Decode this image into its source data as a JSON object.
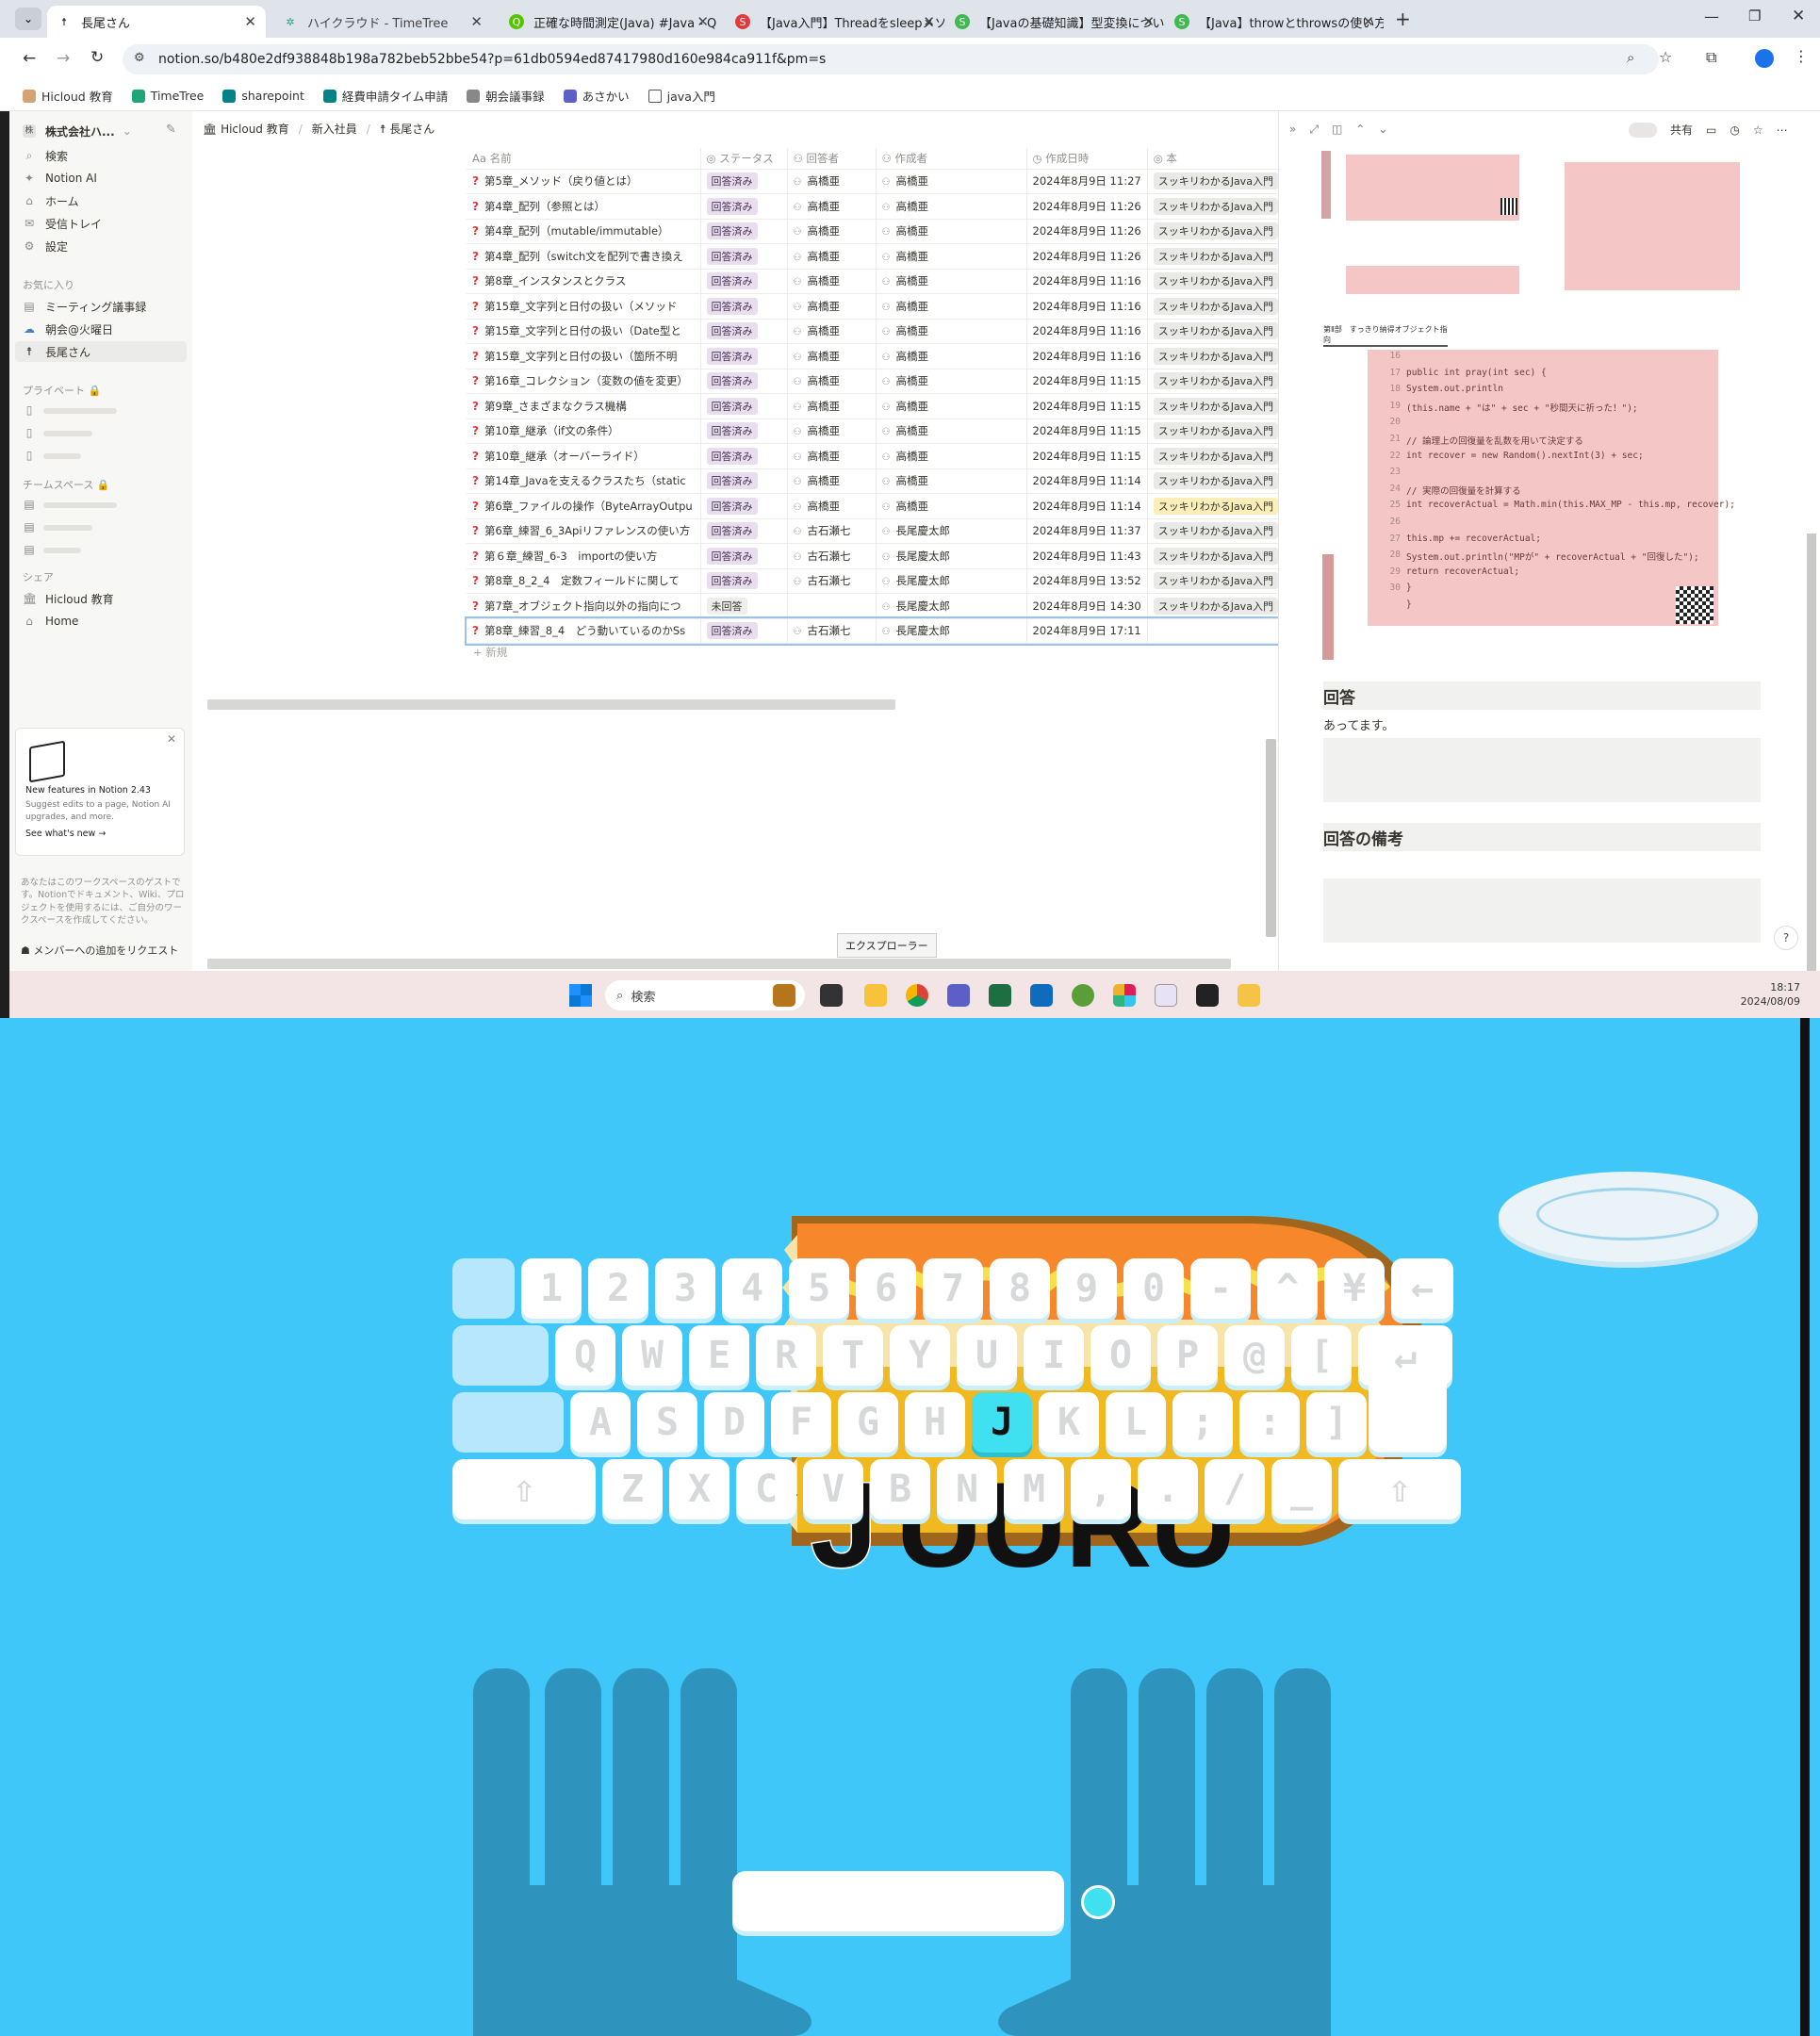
{
  "browser": {
    "tabs": [
      {
        "title": "長尾さん",
        "active": true
      },
      {
        "title": "ハイクラウド - TimeTree"
      },
      {
        "title": "正確な時間測定(Java) #Java - Q"
      },
      {
        "title": "【Java入門】Threadをsleepメソッド"
      },
      {
        "title": "【Javaの基礎知識】型変換について"
      },
      {
        "title": "【Java】throwとthrowsの使い方を"
      }
    ],
    "url": "notion.so/b480e2df938848b198a782beb52bbe54?p=61db0594ed87417980d160e984ca911f&pm=s",
    "bookmarks": [
      "Hicloud 教育",
      "TimeTree",
      "sharepoint",
      "経費申請タイム申請",
      "朝会議事録",
      "あさかい",
      "java入門"
    ]
  },
  "sidebar": {
    "workspace": "株式会社ハ...",
    "nav": [
      "検索",
      "Notion AI",
      "ホーム",
      "受信トレイ",
      "設定"
    ],
    "favorites_label": "お気に入り",
    "favorites": [
      "ミーティング議事録",
      "朝会@火曜日",
      "長尾さん"
    ],
    "private_label": "プライベート",
    "team_label": "チームスペース",
    "shared_label": "シェア",
    "shared": [
      "Hicloud 教育",
      "Home"
    ],
    "promo_title": "New features in Notion 2.43",
    "promo_body": "Suggest edits to a page, Notion AI upgrades, and more.",
    "promo_link": "See what's new",
    "guest_note": "あなたはこのワークスペースのゲストです。Notionでドキュメント、Wiki、プロジェクトを使用するには、ご自分のワークスペースを作成してください。",
    "request_member": "メンバーへの追加をリクエスト"
  },
  "breadcrumb": [
    "Hicloud 教育",
    "新入社員",
    "長尾さん"
  ],
  "table": {
    "headers": [
      "名前",
      "ステータス",
      "回答者",
      "作成者",
      "作成日時",
      "本"
    ],
    "rows": [
      [
        "第5章_メソッド（戻り値とは）",
        "回答済み",
        "高橋亜",
        "高橋亜",
        "2024年8月9日 11:27",
        "スッキリわかるJava入門"
      ],
      [
        "第4章_配列（参照とは）",
        "回答済み",
        "高橋亜",
        "高橋亜",
        "2024年8月9日 11:26",
        "スッキリわかるJava入門"
      ],
      [
        "第4章_配列（mutable/immutable）",
        "回答済み",
        "高橋亜",
        "高橋亜",
        "2024年8月9日 11:26",
        "スッキリわかるJava入門"
      ],
      [
        "第4章_配列（switch文を配列で書き換え",
        "回答済み",
        "高橋亜",
        "高橋亜",
        "2024年8月9日 11:26",
        "スッキリわかるJava入門"
      ],
      [
        "第8章_インスタンスとクラス",
        "回答済み",
        "高橋亜",
        "高橋亜",
        "2024年8月9日 11:16",
        "スッキリわかるJava入門"
      ],
      [
        "第15章_文字列と日付の扱い（メソッド",
        "回答済み",
        "高橋亜",
        "高橋亜",
        "2024年8月9日 11:16",
        "スッキリわかるJava入門"
      ],
      [
        "第15章_文字列と日付の扱い（Date型と",
        "回答済み",
        "高橋亜",
        "高橋亜",
        "2024年8月9日 11:16",
        "スッキリわかるJava入門"
      ],
      [
        "第15章_文字列と日付の扱い（箇所不明",
        "回答済み",
        "高橋亜",
        "高橋亜",
        "2024年8月9日 11:16",
        "スッキリわかるJava入門"
      ],
      [
        "第16章_コレクション（変数の値を変更）",
        "回答済み",
        "高橋亜",
        "高橋亜",
        "2024年8月9日 11:15",
        "スッキリわかるJava入門"
      ],
      [
        "第9章_さまざまなクラス機構",
        "回答済み",
        "高橋亜",
        "高橋亜",
        "2024年8月9日 11:15",
        "スッキリわかるJava入門"
      ],
      [
        "第10章_継承（if文の条件）",
        "回答済み",
        "高橋亜",
        "高橋亜",
        "2024年8月9日 11:15",
        "スッキリわかるJava入門"
      ],
      [
        "第10章_継承（オーバーライド）",
        "回答済み",
        "高橋亜",
        "高橋亜",
        "2024年8月9日 11:15",
        "スッキリわかるJava入門"
      ],
      [
        "第14章_Javaを支えるクラスたち（static",
        "回答済み",
        "高橋亜",
        "高橋亜",
        "2024年8月9日 11:14",
        "スッキリわかるJava入門"
      ],
      [
        "第6章_ファイルの操作（ByteArrayOutpu",
        "回答済み",
        "高橋亜",
        "高橋亜",
        "2024年8月9日 11:14",
        "スッキリわかるJava入門"
      ],
      [
        "第6章_練習_6_3Apiリファレンスの使い方",
        "回答済み",
        "古石瀬七",
        "長尾慶太郎",
        "2024年8月9日 11:37",
        "スッキリわかるJava入門"
      ],
      [
        "第６章_練習_6-3　importの使い方",
        "回答済み",
        "古石瀬七",
        "長尾慶太郎",
        "2024年8月9日 11:43",
        "スッキリわかるJava入門"
      ],
      [
        "第8章_8_2_4　定数フィールドに関して",
        "回答済み",
        "古石瀬七",
        "長尾慶太郎",
        "2024年8月9日 13:52",
        "スッキリわかるJava入門"
      ],
      [
        "第7章_オブジェクト指向以外の指向につ",
        "未回答",
        "",
        "長尾慶太郎",
        "2024年8月9日 14:30",
        "スッキリわかるJava入門"
      ],
      [
        "第8章_練習_8_4　どう動いているのかSs",
        "回答済み",
        "古石瀬七",
        "長尾慶太郎",
        "2024年8月9日 17:11",
        ""
      ]
    ],
    "new_label": "新規"
  },
  "peek": {
    "share": "共有",
    "chapter_header": "第Ⅱ部　すっきり納得オブジェクト指向",
    "code_line_numbers": [
      "16",
      "17",
      "18",
      "19",
      "20",
      "21",
      "22",
      "23",
      "24",
      "25",
      "26",
      "27",
      "28",
      "29",
      "30"
    ],
    "code": [
      "",
      "public int pray(int sec) {",
      "  System.out.println",
      "      (this.name + \"は\" + sec + \"秒間天に祈った！\");",
      "",
      "  // 論理上の回復量を乱数を用いて決定する",
      "  int recover = new Random().nextInt(3) + sec;",
      "",
      "  // 実際の回復量を計算する",
      "  int recoverActual = Math.min(this.MAX_MP - this.mp, recover);",
      "",
      "  this.mp += recoverActual;",
      "  System.out.println(\"MPが\" + recoverActual + \"回復した\");",
      "  return recoverActual;",
      "}",
      "}"
    ],
    "answer_heading": "回答",
    "answer_text": "あってます。",
    "note_heading": "回答の備考"
  },
  "tooltip": "エクスプローラー",
  "taskbar": {
    "search": "検索",
    "time": "18:17",
    "date": "2024/08/09"
  },
  "game": {
    "word": [
      "J",
      "U",
      "U",
      "R",
      "U"
    ],
    "current_letter": "J",
    "keyboard": [
      [
        "",
        "1",
        "2",
        "3",
        "4",
        "5",
        "6",
        "7",
        "8",
        "9",
        "0",
        "-",
        "^",
        "¥",
        "←"
      ],
      [
        "",
        "Q",
        "W",
        "E",
        "R",
        "T",
        "Y",
        "U",
        "I",
        "O",
        "P",
        "@",
        "[",
        "↵"
      ],
      [
        "",
        "A",
        "S",
        "D",
        "F",
        "G",
        "H",
        "J",
        "K",
        "L",
        ";",
        ":",
        "]"
      ],
      [
        "⇧",
        "Z",
        "X",
        "C",
        "V",
        "B",
        "N",
        "M",
        ",",
        ".",
        "/",
        "_",
        "⇧"
      ]
    ],
    "highlight_key": "J"
  }
}
